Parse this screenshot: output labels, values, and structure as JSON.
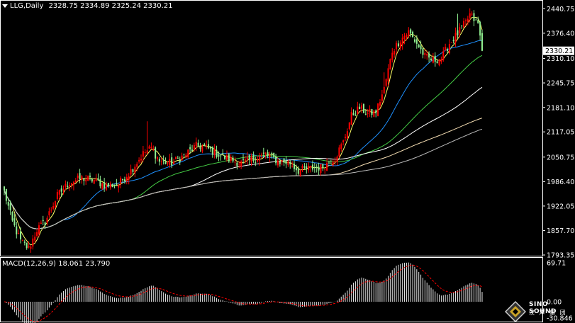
{
  "header": {
    "symbol": "LLG,Daily",
    "ohlc": "2328.75 2334.89 2325.24 2330.21"
  },
  "price_axis": {
    "ticks": [
      "2440.75",
      "2376.40",
      "2310.10",
      "2245.75",
      "2181.10",
      "2117.05",
      "2050.75",
      "1986.40",
      "1922.05",
      "1857.70",
      "1793.35"
    ],
    "current_price": "2330.21"
  },
  "macd": {
    "label": "MACD(12,26,9) 18.061 23.790",
    "axis_top": "69.71",
    "axis_zero": "0.00",
    "axis_bottom": "-30.846"
  },
  "logo": {
    "name": "SINO SOUND",
    "chinese": "汉 声 集 团"
  },
  "colors": {
    "up": "#ff0000",
    "down": "#90ee90",
    "ma_yellow": "#ffff66",
    "ma_blue": "#1e90ff",
    "ma_green": "#44cc44",
    "ma_white": "#ffffff",
    "ma_tan": "#f5deb3",
    "ma_gray": "#bbbbbb",
    "signal": "#ff0000",
    "grid": "#ffffff"
  },
  "chart_data": {
    "type": "candlestick",
    "ylim": [
      1793.35,
      2460
    ],
    "macd_ylim": [
      -30.846,
      69.71
    ],
    "anchors": [
      [
        0,
        1960
      ],
      [
        4,
        1880
      ],
      [
        8,
        1830
      ],
      [
        12,
        1810
      ],
      [
        16,
        1860
      ],
      [
        20,
        1880
      ],
      [
        26,
        1950
      ],
      [
        32,
        1985
      ],
      [
        38,
        1995
      ],
      [
        44,
        1990
      ],
      [
        50,
        1975
      ],
      [
        56,
        1980
      ],
      [
        62,
        2015
      ],
      [
        68,
        2060
      ],
      [
        72,
        2075
      ],
      [
        76,
        2040
      ],
      [
        82,
        2035
      ],
      [
        88,
        2055
      ],
      [
        94,
        2080
      ],
      [
        98,
        2078
      ],
      [
        104,
        2060
      ],
      [
        110,
        2045
      ],
      [
        116,
        2035
      ],
      [
        122,
        2045
      ],
      [
        128,
        2058
      ],
      [
        134,
        2040
      ],
      [
        140,
        2035
      ],
      [
        144,
        2015
      ],
      [
        148,
        2020
      ],
      [
        156,
        2025
      ],
      [
        162,
        2050
      ],
      [
        166,
        2090
      ],
      [
        170,
        2160
      ],
      [
        174,
        2180
      ],
      [
        178,
        2165
      ],
      [
        182,
        2170
      ],
      [
        186,
        2230
      ],
      [
        190,
        2330
      ],
      [
        194,
        2360
      ],
      [
        198,
        2380
      ],
      [
        202,
        2350
      ],
      [
        206,
        2315
      ],
      [
        210,
        2305
      ],
      [
        214,
        2310
      ],
      [
        218,
        2350
      ],
      [
        222,
        2375
      ],
      [
        226,
        2405
      ],
      [
        228,
        2425
      ],
      [
        232,
        2400
      ],
      [
        234,
        2335
      ]
    ]
  }
}
